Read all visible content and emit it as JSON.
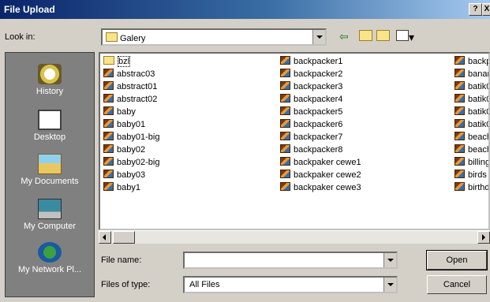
{
  "window": {
    "title": "File Upload",
    "help_label": "?",
    "close_label": "X"
  },
  "look_in": {
    "label": "Look in:",
    "value": "Galery"
  },
  "toolbar": {
    "back_icon": "back-arrow-icon",
    "up_icon": "up-folder-icon",
    "new_folder_icon": "new-folder-icon",
    "views_icon": "views-menu-icon"
  },
  "places": [
    {
      "label": "History",
      "icon": "history-icon"
    },
    {
      "label": "Desktop",
      "icon": "desktop-icon"
    },
    {
      "label": "My Documents",
      "icon": "my-documents-icon"
    },
    {
      "label": "My Computer",
      "icon": "my-computer-icon"
    },
    {
      "label": "My Network Pl...",
      "icon": "network-places-icon"
    }
  ],
  "files": {
    "col1": [
      "bzl",
      "abstrac03",
      "abstract01",
      "abstract02",
      "baby",
      "baby01",
      "baby01-big",
      "baby02",
      "baby02-big",
      "baby03",
      "baby1"
    ],
    "col2": [
      "backpacker1",
      "backpacker2",
      "backpacker3",
      "backpacker4",
      "backpacker5",
      "backpacker6",
      "backpacker7",
      "backpacker8",
      "backpaker cewe1",
      "backpaker cewe2",
      "backpaker cewe3"
    ],
    "col3": [
      "backp",
      "banar",
      "batik0",
      "batik0",
      "batik0",
      "batik0",
      "beach",
      "beach",
      "billing",
      "birds",
      "birthd"
    ]
  },
  "file_name": {
    "label": "File name:",
    "value": ""
  },
  "files_of_type": {
    "label": "Files of type:",
    "value": "All Files"
  },
  "buttons": {
    "open": "Open",
    "cancel": "Cancel"
  }
}
